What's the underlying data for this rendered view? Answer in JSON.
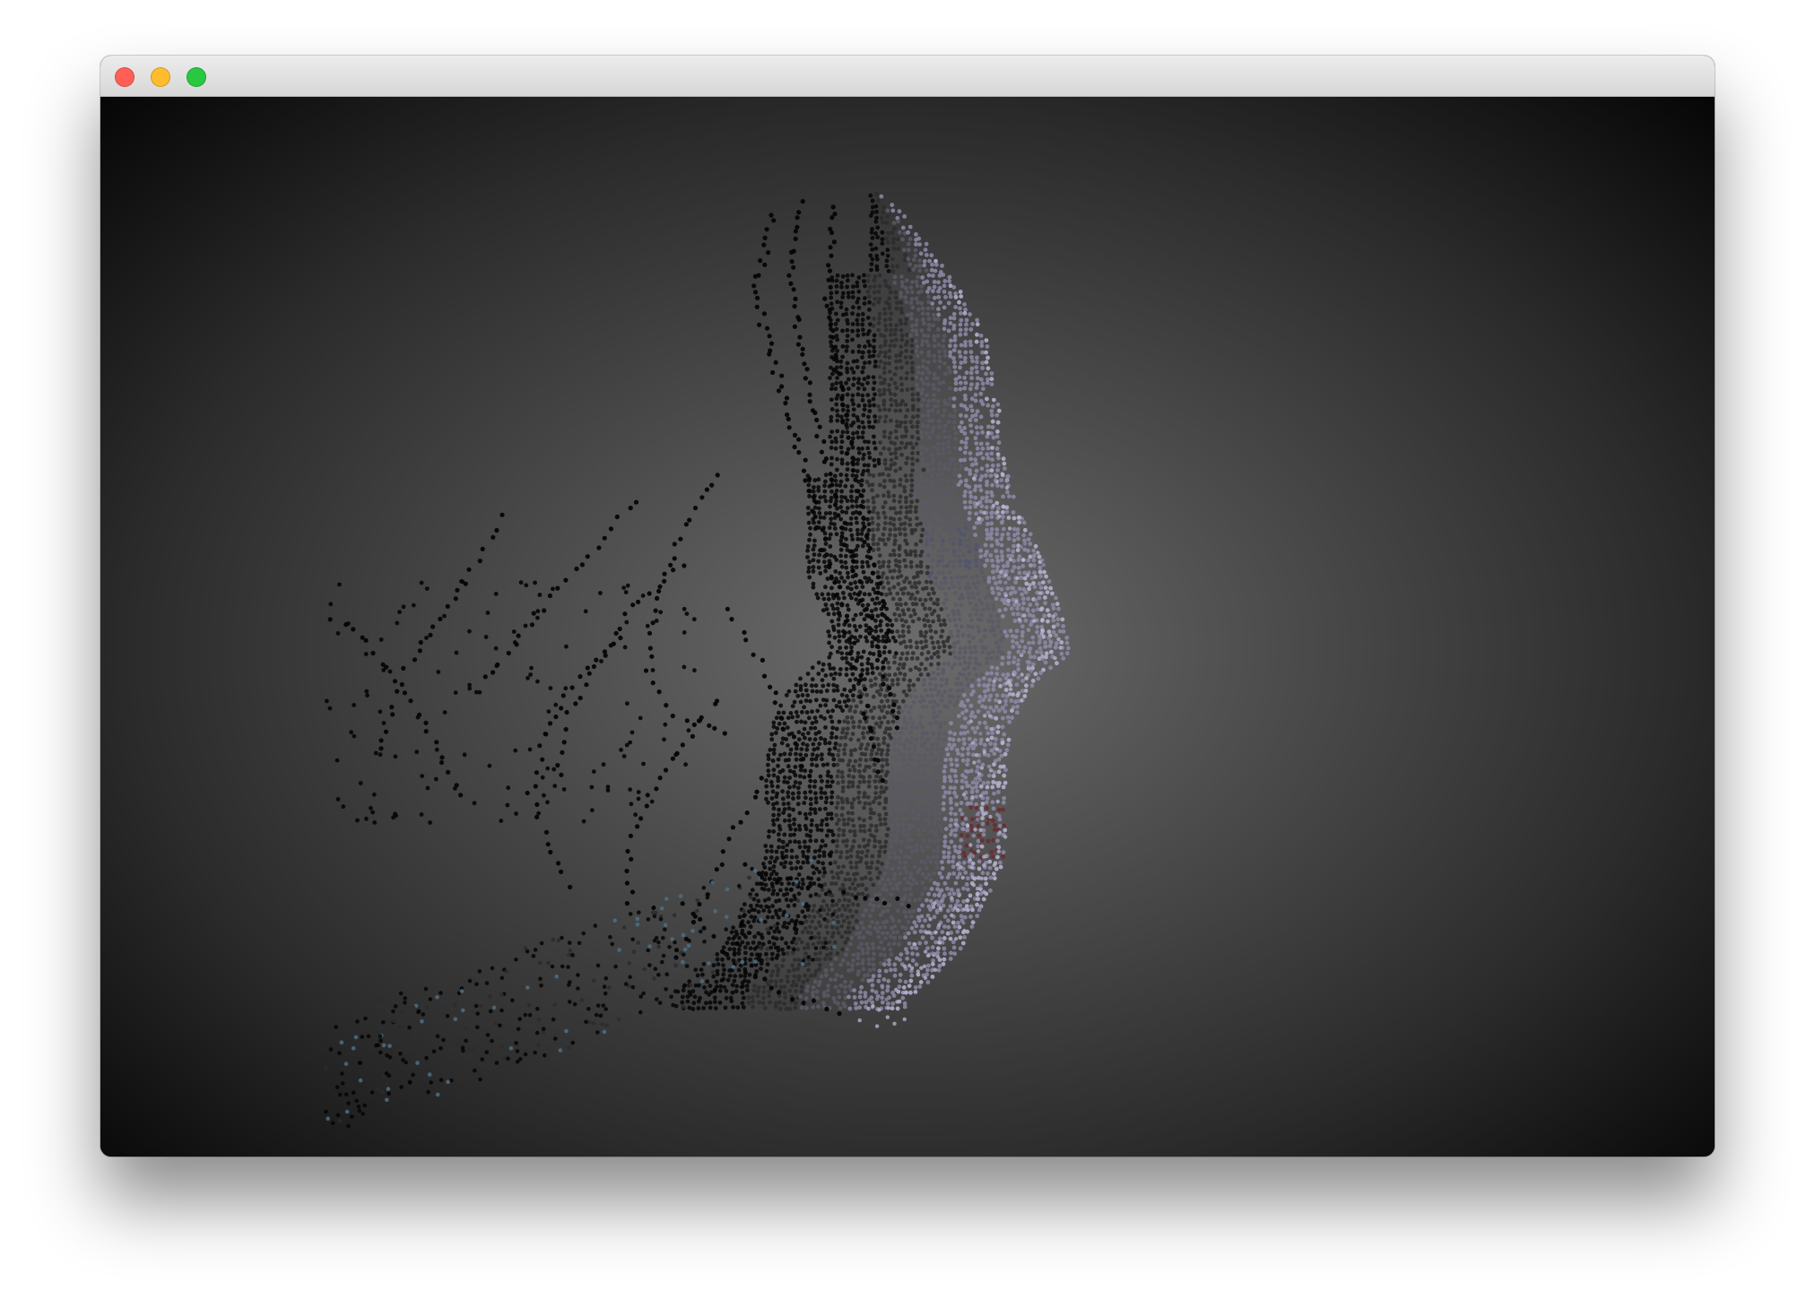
{
  "window": {
    "title": "",
    "controls": {
      "close_color": "#ff5f57",
      "minimize_color": "#febc2e",
      "zoom_color": "#28c840"
    }
  },
  "viewport": {
    "content": "3d-face-point-cloud",
    "background_center_color": "#6c6c6c",
    "background_edge_color": "#060606",
    "point_colors": [
      "#050505",
      "#2b2b2e",
      "#5a5865",
      "#8f8aa8",
      "#b9b6d4",
      "#6b2a2f",
      "#4d6f84"
    ]
  }
}
